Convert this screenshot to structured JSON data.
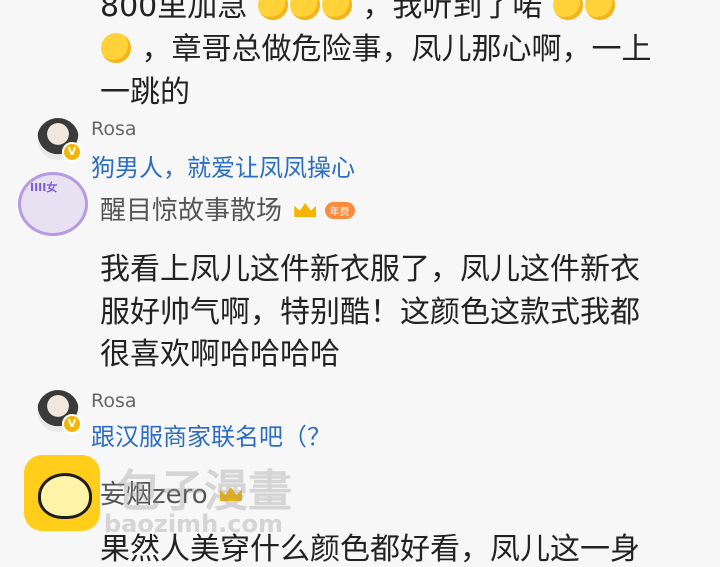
{
  "comment1": {
    "line1_text": "800里加急",
    "line1_tail": "，我听到了喏",
    "line2_text": "，章哥总做危险事，凤儿那心啊，一上",
    "line3_text": "一跳的"
  },
  "reply1": {
    "username": "Rosa",
    "text": "狗男人，就爱让凤凤操心"
  },
  "post2": {
    "username": "醒目惊故事散场",
    "badge": "年费",
    "avatar_text": "IIII女",
    "line1": "我看上凤儿这件新衣服了，凤儿这件新衣",
    "line2": "服好帅气啊，特别酷！这颜色这款式我都",
    "line3": "很喜欢啊哈哈哈哈"
  },
  "reply2": {
    "username": "Rosa",
    "text": "跟汉服商家联名吧（？"
  },
  "post3": {
    "username": "妄烟zero",
    "line1": "果然人美穿什么颜色都好看，凤儿这一身"
  },
  "watermark": {
    "title": "包子漫畫",
    "url": "baozimh.com"
  },
  "icons": [
    "laugh-cry-emoji",
    "thinking-emoji",
    "v-badge-icon",
    "crown-icon"
  ]
}
